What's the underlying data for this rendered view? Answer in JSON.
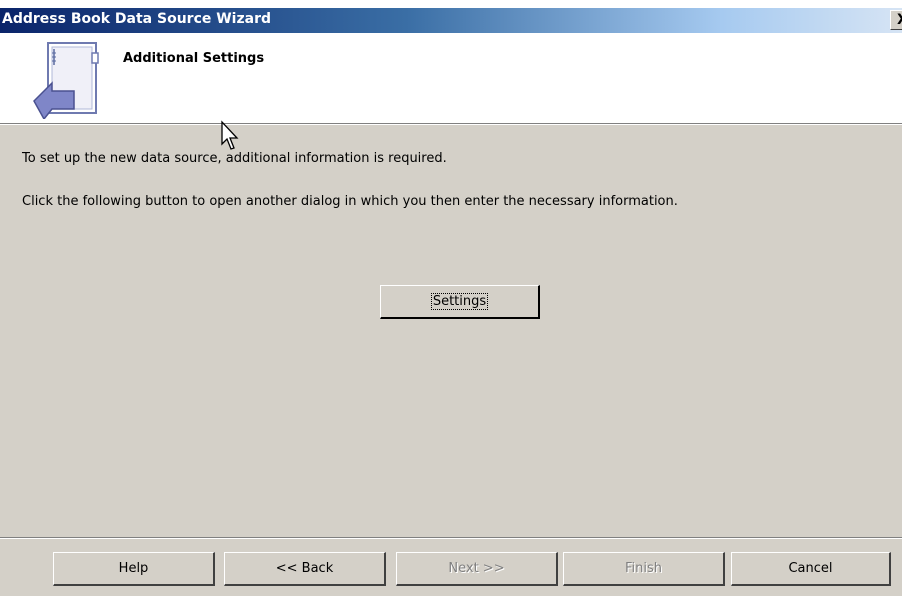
{
  "window": {
    "title": "Address Book Data Source Wizard",
    "close_label": "X"
  },
  "header": {
    "page_title": "Additional Settings",
    "icon": "address-book-wizard-icon"
  },
  "content": {
    "line1": "To set up the new data source, additional information is required.",
    "line2": "Click the following button to open another dialog in which you then enter the necessary information.",
    "settings_button": "Settings"
  },
  "buttons": {
    "help": "Help",
    "back": "<< Back",
    "next": "Next >>",
    "finish": "Finish",
    "cancel": "Cancel"
  },
  "state": {
    "next_enabled": false,
    "finish_enabled": false
  }
}
